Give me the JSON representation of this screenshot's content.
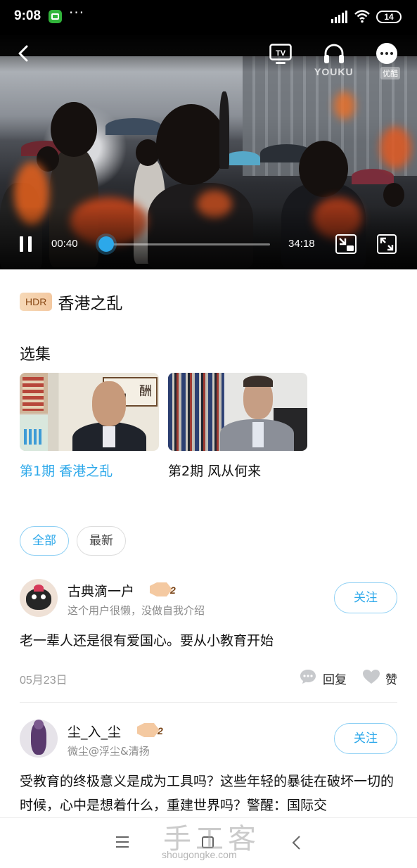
{
  "status_bar": {
    "time": "9:08",
    "more_indicator": "···",
    "battery_level": "14",
    "icons": [
      "wechat-app-icon",
      "signal-icon",
      "wifi-icon",
      "battery-icon"
    ]
  },
  "player": {
    "watermark_brand": "YOUKU",
    "watermark_cn": "优酷",
    "elapsed": "00:40",
    "duration": "34:18",
    "progress_fraction": 0.019,
    "accent_color": "#2ca8ea",
    "icons": [
      "back-icon",
      "tv-cast-icon",
      "headphones-icon",
      "more-icon",
      "pause-icon",
      "mini-window-icon",
      "fullscreen-icon"
    ]
  },
  "show": {
    "badge": "HDR",
    "title": "香港之乱"
  },
  "episodes_section": {
    "heading": "选集",
    "episodes": [
      {
        "label": "第1期 香港之乱",
        "selected": true
      },
      {
        "label": "第2期 风从何来",
        "selected": false
      }
    ]
  },
  "filters": {
    "all": "全部",
    "latest": "最新",
    "active": "全部"
  },
  "comments": [
    {
      "user": "古典滴一户",
      "level": "2",
      "bio": "这个用户很懒，没做自我介绍",
      "follow": "关注",
      "text": "老一辈人还是很有爱国心。要从小教育开始",
      "date": "05月23日",
      "reply": "回复",
      "like": "赞"
    },
    {
      "user": "尘_入_尘",
      "level": "2",
      "bio": "微尘@浮尘&清扬",
      "follow": "关注",
      "text": "受教育的终极意义是成为工具吗？这些年轻的暴徒在破坏一切的时候，心中是想着什么，重建世界吗？警醒：国际交"
    }
  ],
  "watermark": {
    "big": "手工客",
    "small": "shougongke.com"
  },
  "nav_bar": {
    "icons": [
      "menu-icon",
      "home-icon",
      "back-nav-icon"
    ]
  }
}
